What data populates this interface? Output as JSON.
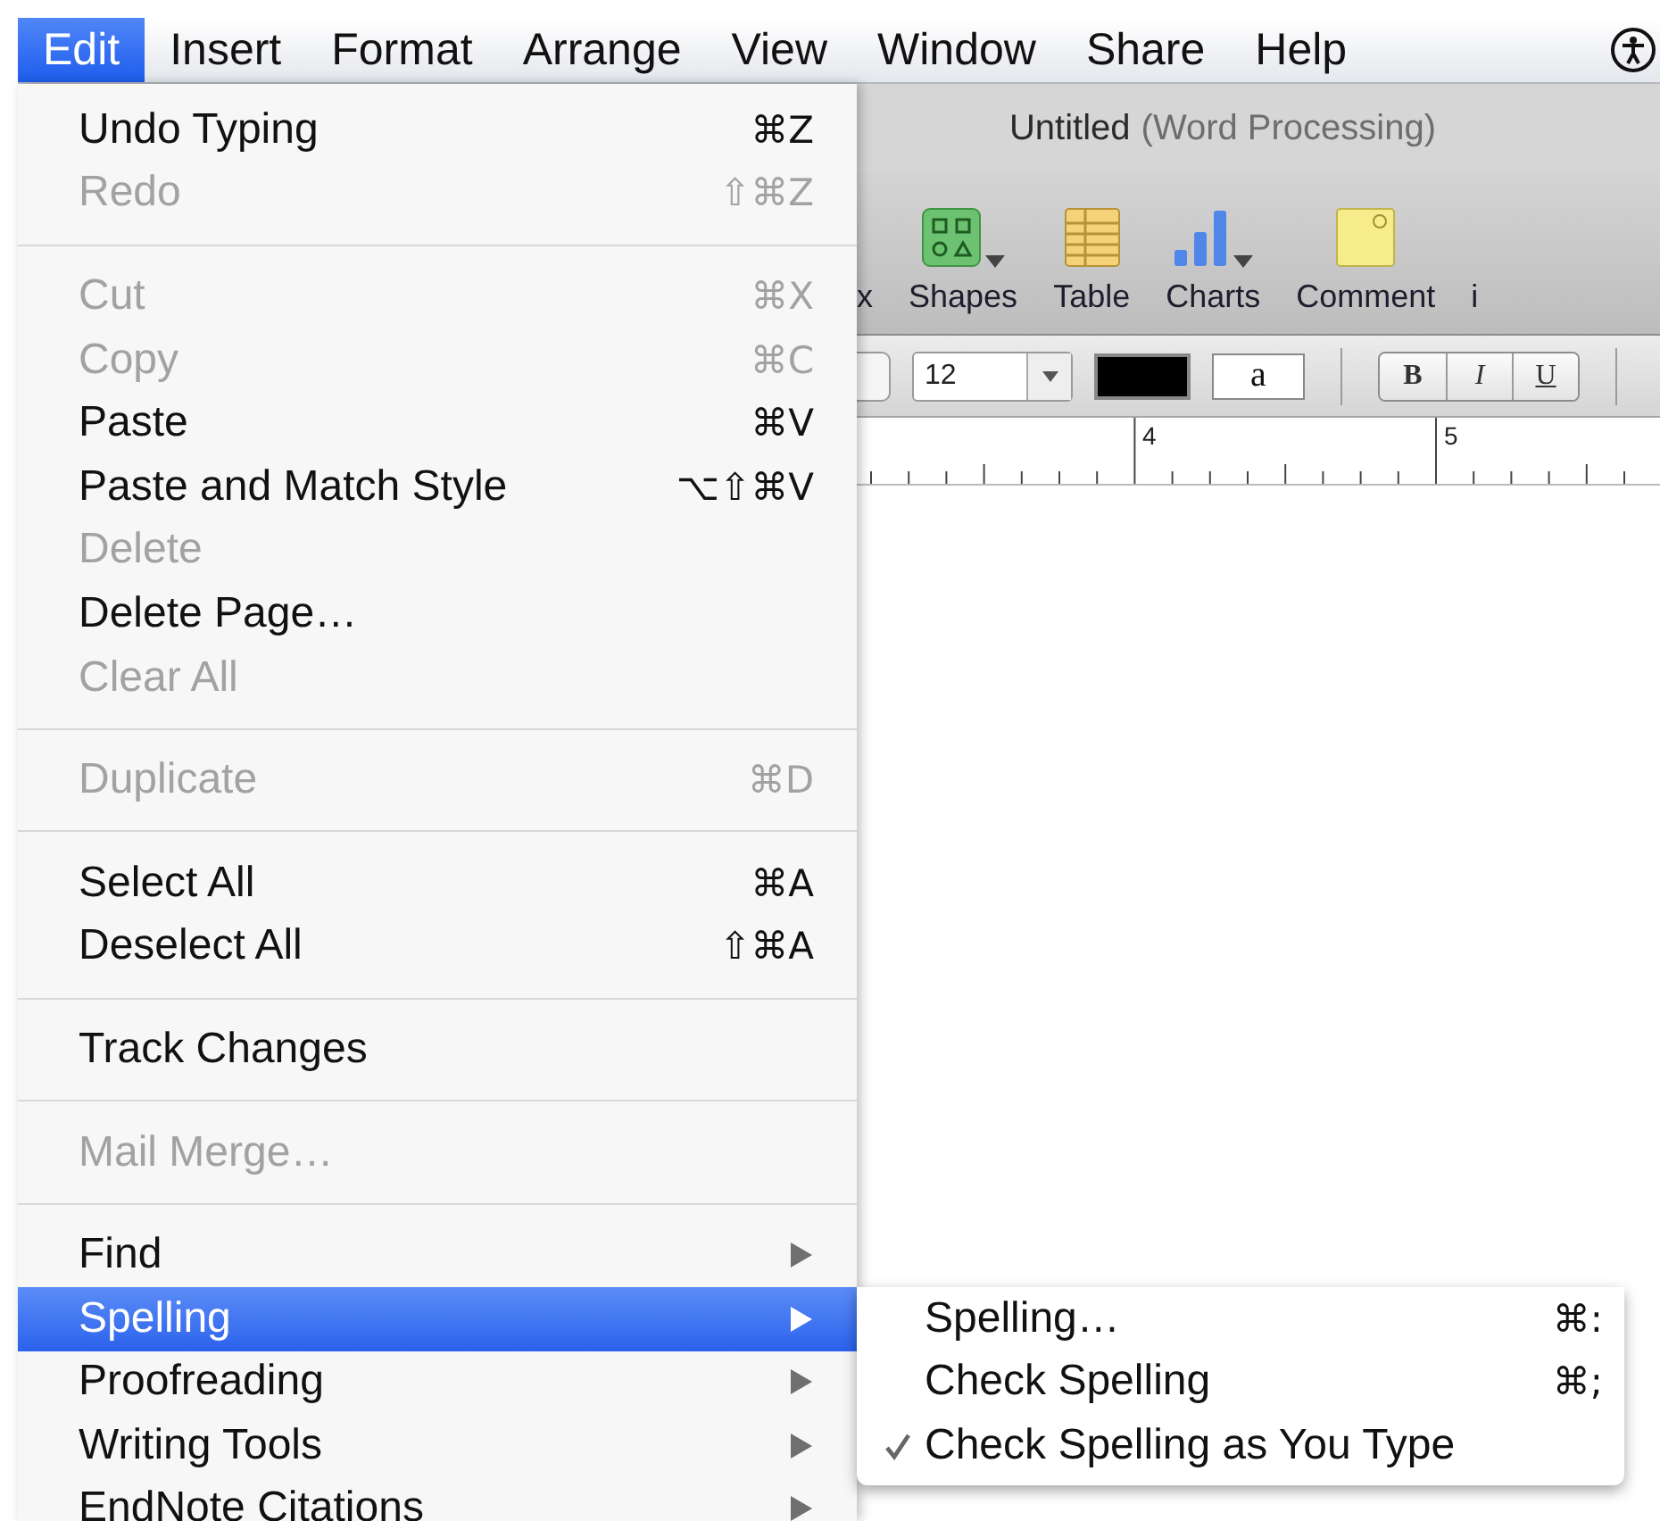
{
  "menu_bar": {
    "items": [
      {
        "label": "Edit",
        "selected": true
      },
      {
        "label": "Insert",
        "selected": false
      },
      {
        "label": "Format",
        "selected": false
      },
      {
        "label": "Arrange",
        "selected": false
      },
      {
        "label": "View",
        "selected": false
      },
      {
        "label": "Window",
        "selected": false
      },
      {
        "label": "Share",
        "selected": false
      },
      {
        "label": "Help",
        "selected": false
      }
    ]
  },
  "window": {
    "title": "Untitled",
    "subtitle": "(Word Processing)",
    "toolbar": [
      {
        "kind": "text",
        "label": "x"
      },
      {
        "kind": "shapes",
        "label": "Shapes",
        "dropdown": true
      },
      {
        "kind": "table",
        "label": "Table",
        "dropdown": false
      },
      {
        "kind": "charts",
        "label": "Charts",
        "dropdown": true
      },
      {
        "kind": "comment",
        "label": "Comment",
        "dropdown": false
      },
      {
        "kind": "text",
        "label": "i"
      }
    ],
    "format_bar": {
      "font_size": "12",
      "text_color_sample": "a",
      "style_buttons": [
        "B",
        "I",
        "U"
      ]
    },
    "ruler": {
      "labels": [
        "4",
        "5"
      ]
    }
  },
  "edit_menu": {
    "groups": [
      [
        {
          "kind": "command",
          "label": "Undo Typing",
          "shortcut": "⌘Z",
          "disabled": false,
          "selected": false
        },
        {
          "kind": "command",
          "label": "Redo",
          "shortcut": "⇧⌘Z",
          "disabled": true,
          "selected": false
        }
      ],
      [
        {
          "kind": "command",
          "label": "Cut",
          "shortcut": "⌘X",
          "disabled": true,
          "selected": false
        },
        {
          "kind": "command",
          "label": "Copy",
          "shortcut": "⌘C",
          "disabled": true,
          "selected": false
        },
        {
          "kind": "command",
          "label": "Paste",
          "shortcut": "⌘V",
          "disabled": false,
          "selected": false
        },
        {
          "kind": "command",
          "label": "Paste and Match Style",
          "shortcut": "⌥⇧⌘V",
          "disabled": false,
          "selected": false
        },
        {
          "kind": "command",
          "label": "Delete",
          "disabled": true,
          "selected": false
        },
        {
          "kind": "command",
          "label": "Delete Page…",
          "disabled": false,
          "selected": false
        },
        {
          "kind": "command",
          "label": "Clear All",
          "disabled": true,
          "selected": false
        }
      ],
      [
        {
          "kind": "command",
          "label": "Duplicate",
          "shortcut": "⌘D",
          "disabled": true,
          "selected": false
        }
      ],
      [
        {
          "kind": "command",
          "label": "Select All",
          "shortcut": "⌘A",
          "disabled": false,
          "selected": false
        },
        {
          "kind": "command",
          "label": "Deselect All",
          "shortcut": "⇧⌘A",
          "disabled": false,
          "selected": false
        }
      ],
      [
        {
          "kind": "command",
          "label": "Track Changes",
          "disabled": false,
          "selected": false
        }
      ],
      [
        {
          "kind": "command",
          "label": "Mail Merge…",
          "disabled": true,
          "selected": false
        }
      ],
      [
        {
          "kind": "submenu",
          "label": "Find",
          "disabled": false,
          "selected": false
        },
        {
          "kind": "submenu",
          "label": "Spelling",
          "disabled": false,
          "selected": true,
          "submenu": [
            {
              "label": "Spelling…",
              "shortcut": "⌘:",
              "checked": false
            },
            {
              "label": "Check Spelling",
              "shortcut": "⌘;",
              "checked": false
            },
            {
              "label": "Check Spelling as You Type",
              "checked": true
            }
          ]
        },
        {
          "kind": "submenu",
          "label": "Proofreading",
          "disabled": false,
          "selected": false
        },
        {
          "kind": "submenu",
          "label": "Writing Tools",
          "disabled": false,
          "selected": false
        },
        {
          "kind": "submenu",
          "label": "EndNote Citations",
          "disabled": false,
          "selected": false
        }
      ]
    ]
  }
}
